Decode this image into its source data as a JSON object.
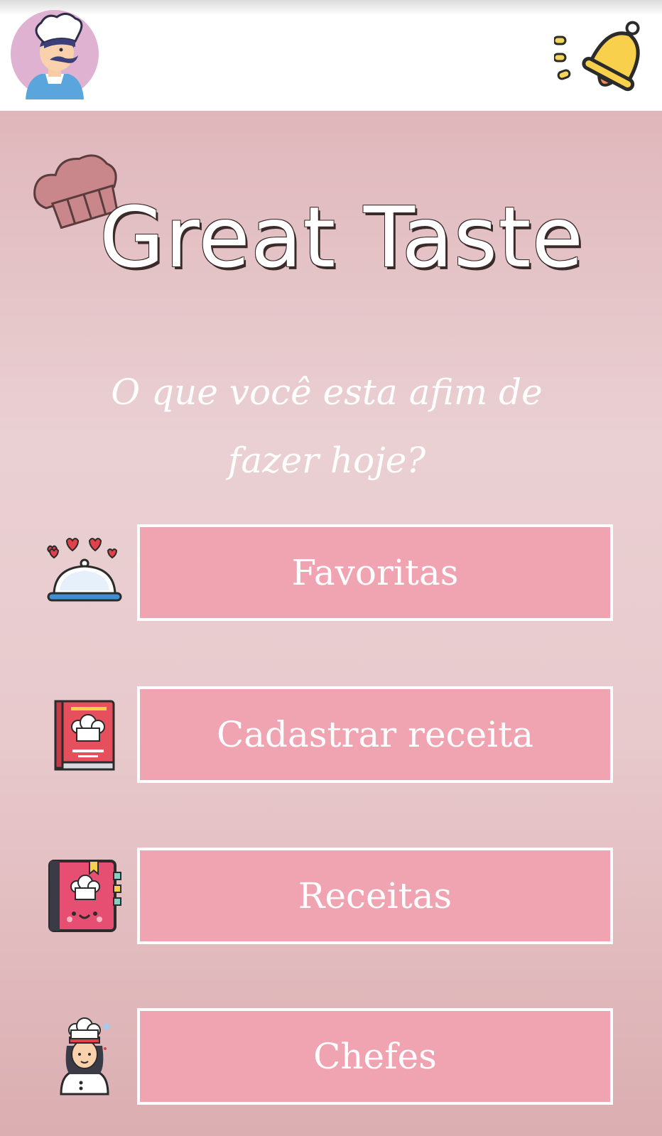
{
  "app": {
    "title": "Great Taste",
    "subtitle": "O que você esta afim de fazer hoje?"
  },
  "header": {
    "avatar_icon": "chef-avatar-icon",
    "notification_icon": "bell-icon"
  },
  "menu": {
    "items": [
      {
        "label": "Favoritas",
        "icon": "serving-cloche-hearts-icon"
      },
      {
        "label": "Cadastrar receita",
        "icon": "recipe-book-icon"
      },
      {
        "label": "Receitas",
        "icon": "recipe-notebook-icon"
      },
      {
        "label": "Chefes",
        "icon": "chef-woman-icon"
      }
    ]
  },
  "colors": {
    "button_fill": "#f0a4b2",
    "button_border": "#ffffff",
    "background_top": "#dfb7bb",
    "background_bottom": "#dbaeb1"
  }
}
